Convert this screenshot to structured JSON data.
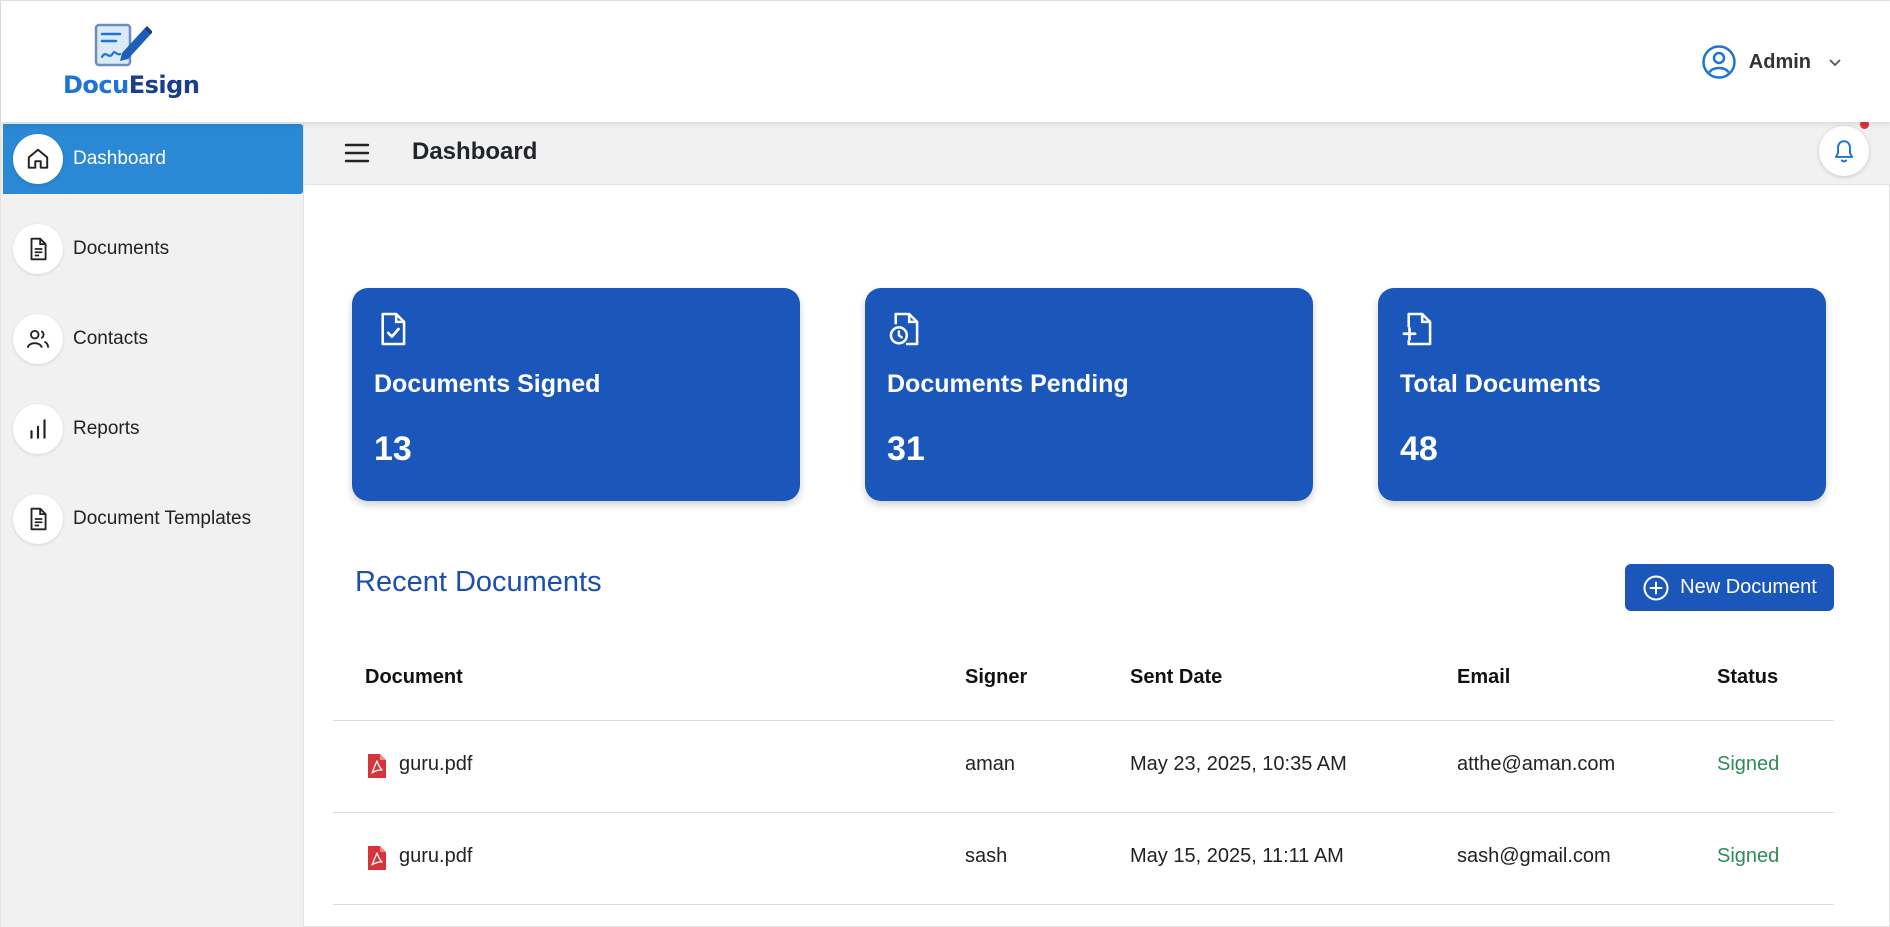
{
  "brand": {
    "name_part1": "Docu",
    "name_part2": "Esign",
    "primary_color": "#1b57ba",
    "accent_color": "#2a88d4"
  },
  "user": {
    "name": "Admin",
    "icon": "user-circle-icon"
  },
  "sidebar": {
    "items": [
      {
        "label": "Dashboard",
        "icon": "home-icon",
        "active": true
      },
      {
        "label": "Documents",
        "icon": "document-icon",
        "active": false
      },
      {
        "label": "Contacts",
        "icon": "users-icon",
        "active": false
      },
      {
        "label": "Reports",
        "icon": "bar-chart-icon",
        "active": false
      },
      {
        "label": "Document Templates",
        "icon": "document-template-icon",
        "active": false
      }
    ]
  },
  "pagebar": {
    "title": "Dashboard",
    "notification_icon": "bell-icon"
  },
  "stats": [
    {
      "label": "Documents Signed",
      "value": "13",
      "icon": "file-check-icon"
    },
    {
      "label": "Documents Pending",
      "value": "31",
      "icon": "file-clock-icon"
    },
    {
      "label": "Total Documents",
      "value": "48",
      "icon": "file-plus-icon"
    }
  ],
  "recent": {
    "title": "Recent Documents",
    "new_button": "New Document",
    "columns": [
      "Document",
      "Signer",
      "Sent Date",
      "Email",
      "Status"
    ],
    "rows": [
      {
        "document": "guru.pdf",
        "signer": "aman",
        "sent_date": "May 23, 2025, 10:35 AM",
        "email": "atthe@aman.com",
        "status": "Signed"
      },
      {
        "document": "guru.pdf",
        "signer": "sash",
        "sent_date": "May 15, 2025, 11:11 AM",
        "email": "sash@gmail.com",
        "status": "Signed"
      }
    ],
    "status_color": "#2e8b57"
  }
}
